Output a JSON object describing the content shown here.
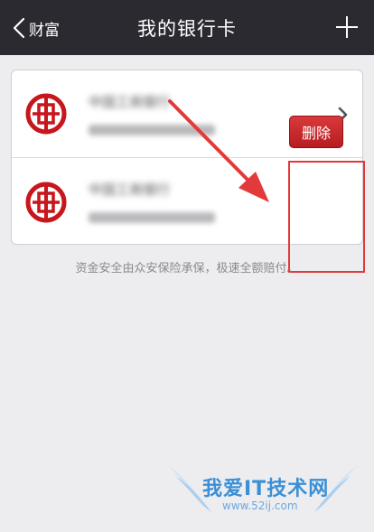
{
  "header": {
    "back_label": "财富",
    "title": "我的银行卡"
  },
  "cards": [
    {
      "bank_name": "中国工商银行",
      "has_chevron": true
    },
    {
      "bank_name": "中国工商银行",
      "action_label": "删除"
    }
  ],
  "note": "资金安全由众安保险承保，极速全额赔付。",
  "watermark": {
    "text": "我爱IT技术网",
    "url": "www.52ij.com"
  },
  "colors": {
    "topbar": "#2b2a30",
    "background": "#ededf0",
    "bank_logo_red": "#c8161d",
    "delete_red": "#c62a2e",
    "annotation_red": "#e23a3a"
  }
}
